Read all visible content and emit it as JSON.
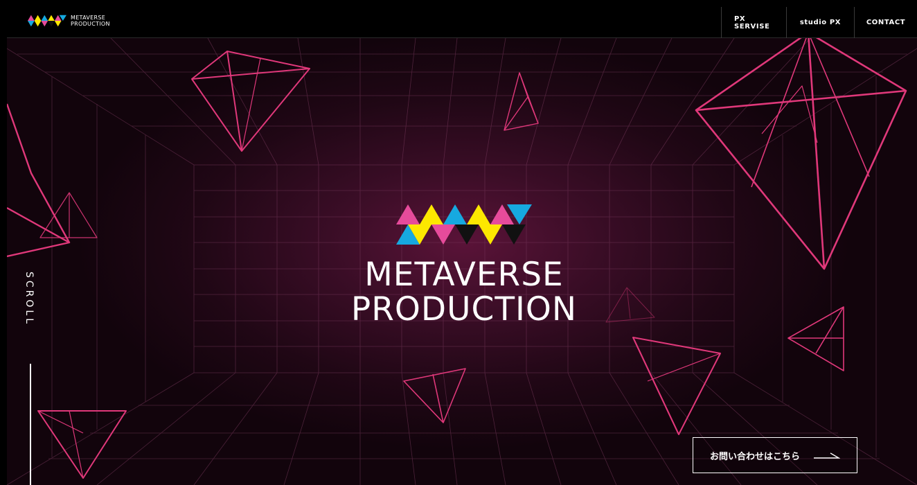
{
  "header": {
    "logo_text_line1": "METAVERSE",
    "logo_text_line2": "PRODUCTION",
    "nav": [
      {
        "label": "PX SERVISE"
      },
      {
        "label": "studio PX"
      },
      {
        "label": "CONTACT"
      }
    ]
  },
  "hero": {
    "title_line1": "METAVERSE",
    "title_line2": "PRODUCTION"
  },
  "scroll": {
    "label": "SCROLL"
  },
  "cta": {
    "label": "お問い合わせはこちら",
    "arrow_icon": "long-arrow-right-icon"
  },
  "colors": {
    "accent_pink": "#e0387a",
    "cyan": "#16a9e0",
    "yellow": "#fde800",
    "magenta": "#e64b9b",
    "grid": "#7a3a5e",
    "background": "#2a0a1c"
  }
}
